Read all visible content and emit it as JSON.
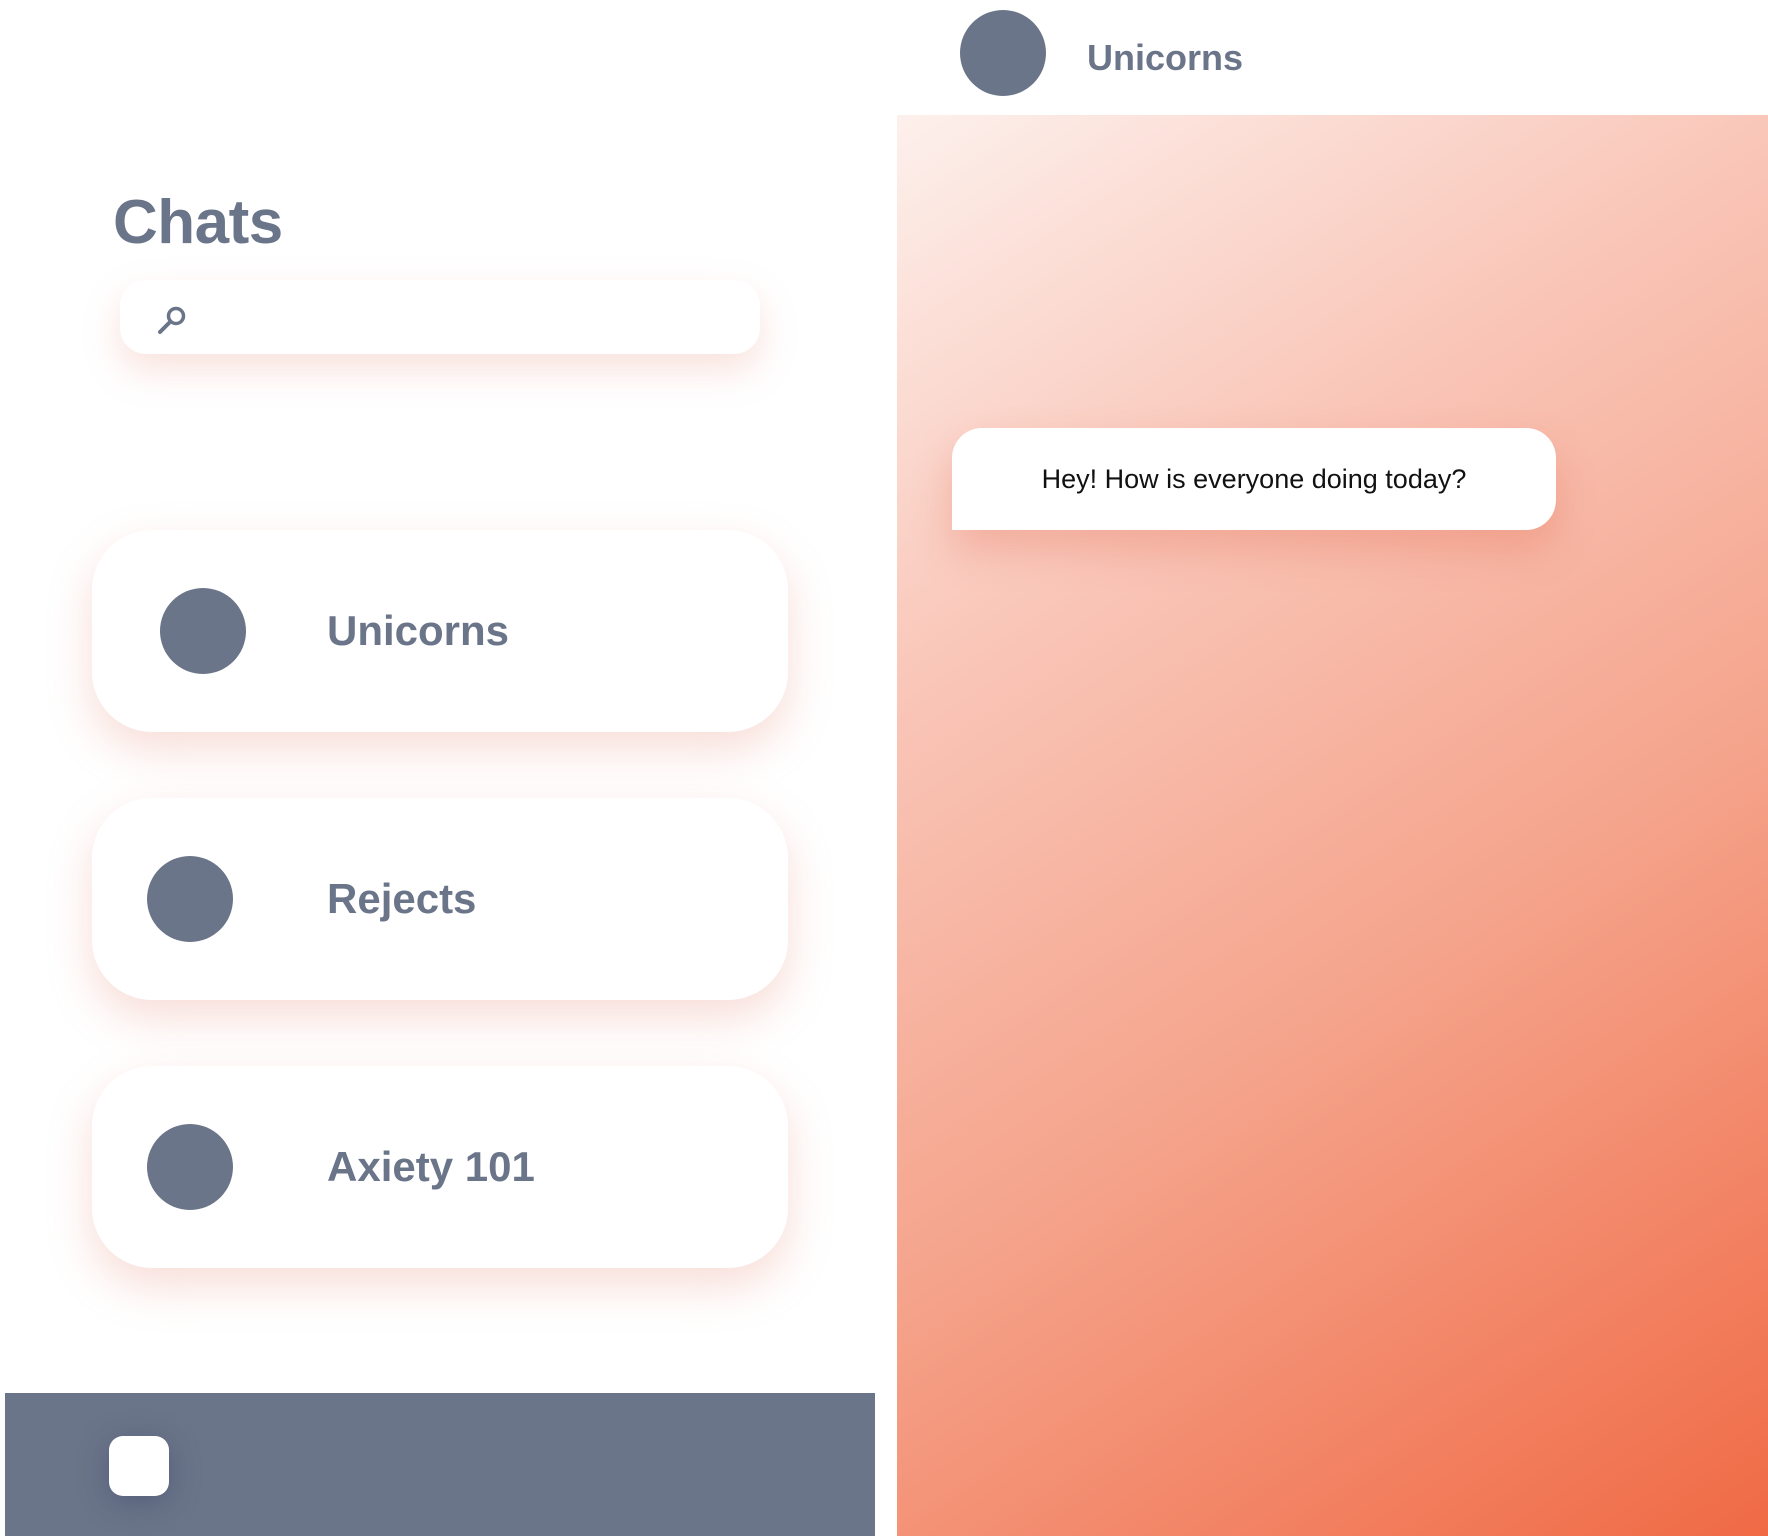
{
  "sidebar": {
    "title": "Chats",
    "search": {
      "icon": "search-icon",
      "placeholder": "",
      "value": ""
    },
    "chats": [
      {
        "name": "Unicorns"
      },
      {
        "name": "Rejects"
      },
      {
        "name": "Axiety 101"
      }
    ],
    "bottom_bar": {
      "button_icon": "square-button"
    }
  },
  "conversation": {
    "header": {
      "title": "Unicorns"
    },
    "messages": [
      {
        "text": "Hey! How is everyone doing today?"
      }
    ]
  },
  "colors": {
    "slate": "#6b7589",
    "white": "#ffffff",
    "gradient_start": "#fdf0ec",
    "gradient_end": "#f06a45"
  }
}
